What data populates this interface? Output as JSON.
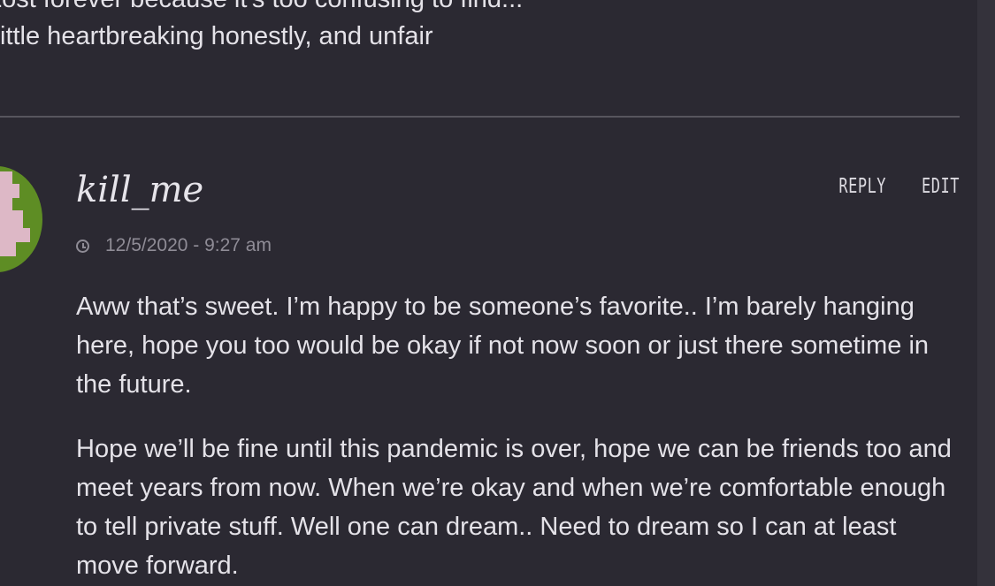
{
  "previous_comment": {
    "line1": "Lost forever because it's too confusing to find...",
    "line2": "ittle heartbreaking honestly, and unfair"
  },
  "comment": {
    "author": "kill_me",
    "timestamp": "12/5/2020 - 9:27 am",
    "actions": {
      "reply": "Reply",
      "edit": "Edit"
    },
    "paragraphs": [
      "Aww that’s sweet. I’m happy to be someone’s favorite.. I’m barely hanging here, hope you too would be okay if not now soon or just there sometime in the future.",
      "Hope we’ll be fine until this pandemic is over, hope we can be friends too and meet years from now. When we’re okay and when we’re comfortable enough to tell private stuff. Well one can dream.. Need to dream so I can at least move forward."
    ]
  },
  "icons": {
    "timestamp": "clock-icon"
  },
  "colors": {
    "background": "#2b2932",
    "divider": "#57555d",
    "avatar_green": "#5e8d24",
    "avatar_pink": "#ddb8c6",
    "meta_text": "#8f8c96"
  }
}
